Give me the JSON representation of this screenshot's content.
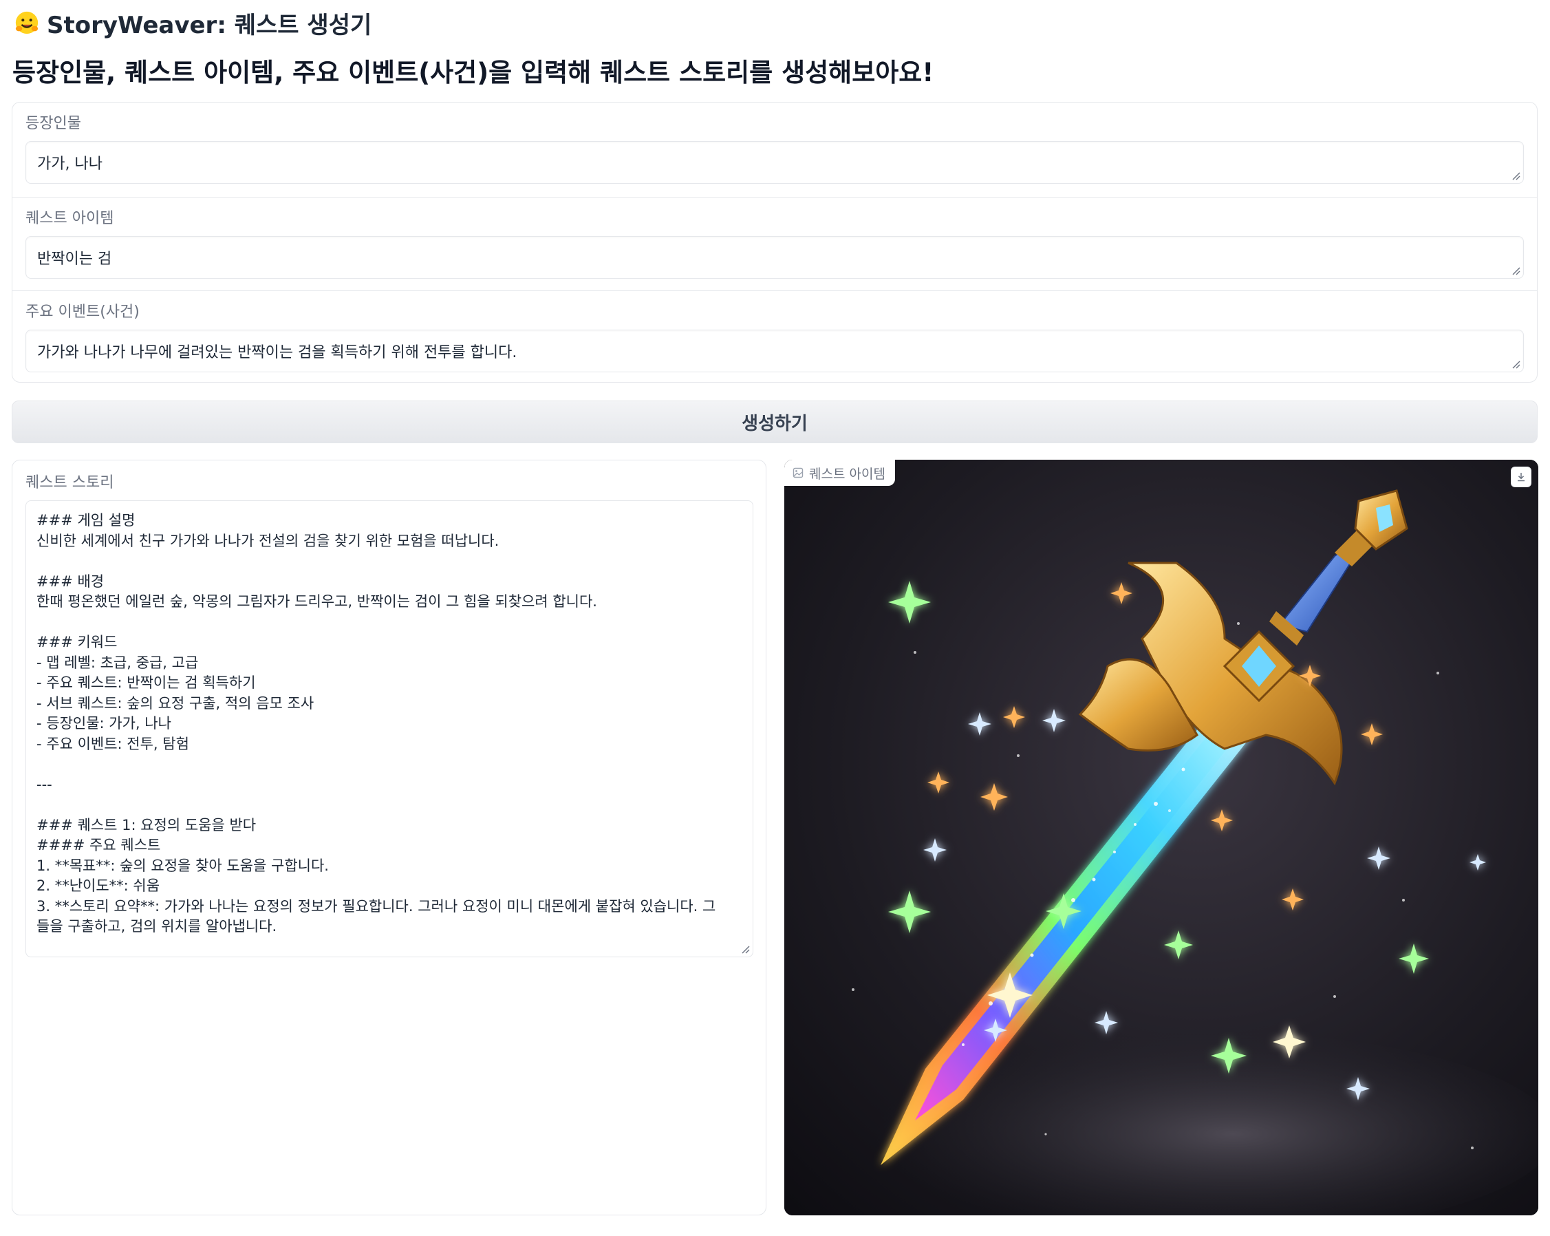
{
  "header": {
    "title": "StoryWeaver: 퀘스트 생성기",
    "subtitle": "등장인물, 퀘스트 아이템, 주요 이벤트(사건)을 입력해 퀘스트 스토리를 생성해보아요!"
  },
  "inputs": {
    "characters": {
      "label": "등장인물",
      "value": "가가, 나나"
    },
    "item": {
      "label": "퀘스트 아이템",
      "value": "반짝이는 검"
    },
    "event": {
      "label": "주요 이벤트(사건)",
      "value": "가가와 나나가 나무에 걸려있는 반짝이는 검을 획득하기 위해 전투를 합니다."
    }
  },
  "generate_button": {
    "label": "생성하기"
  },
  "story": {
    "label": "퀘스트 스토리",
    "lines": [
      "### 게임 설명",
      "신비한 세계에서 친구 가가와 나나가 전설의 검을 찾기 위한 모험을 떠납니다.",
      "",
      "### 배경",
      "한때 평온했던 에일런 숲, 악몽의 그림자가 드리우고, 반짝이는 검이 그 힘을 되찾으려 합니다.",
      "",
      "### 키워드",
      "- 맵 레벨: 초급, 중급, 고급",
      "- 주요 퀘스트: 반짝이는 검 획득하기",
      "- 서브 퀘스트: 숲의 요정 구출, 적의 음모 조사",
      "- 등장인물: 가가, 나나",
      "- 주요 이벤트: 전투, 탐험",
      "",
      "---",
      "",
      "### 퀘스트 1: 요정의 도움을 받다",
      "#### 주요 퀘스트",
      "1. **목표**: 숲의 요정을 찾아 도움을 구합니다.",
      "2. **난이도**: 쉬움",
      "3. **스토리 요약**: 가가와 나나는 요정의 정보가 필요합니다. 그러나 요정이 미니 대몬에게 붙잡혀 있습니다. 그",
      "들을 구출하고, 검의 위치를 알아냅니다."
    ]
  },
  "image": {
    "label": "퀘스트 아이템",
    "icons": {
      "tag": "image-icon",
      "download": "download-icon"
    }
  }
}
